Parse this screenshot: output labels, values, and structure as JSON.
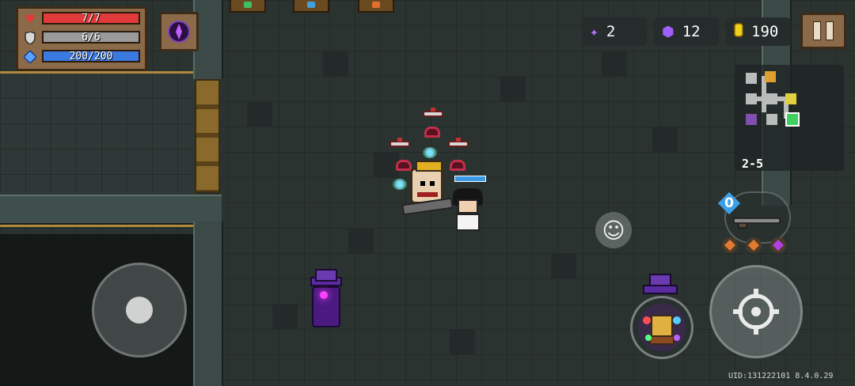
{
  "player_stats": {
    "health": {
      "label": "7/7",
      "current": 7,
      "max": 7,
      "color": "#e03a3a",
      "icon": "heart-icon"
    },
    "armor": {
      "label": "6/6",
      "current": 6,
      "max": 6,
      "color": "#9a9a9a",
      "icon": "shield-icon"
    },
    "energy": {
      "label": "200/200",
      "current": 200,
      "max": 200,
      "color": "#3a7ae0",
      "icon": "energy-crystal-icon"
    }
  },
  "skill_button": {
    "icon": "purple-spirit-skill-icon"
  },
  "resources": {
    "gems": {
      "value": "2",
      "icon": "purple-star-gem-icon",
      "color": "#b070ff"
    },
    "materials": {
      "value": "12",
      "icon": "purple-coin-icon",
      "color": "#a060ff"
    },
    "gold": {
      "value": "190",
      "icon": "gold-coin-icon",
      "color": "#f0d020"
    }
  },
  "pause_button": {
    "icon": "pause-icon"
  },
  "minimap": {
    "level": "2-5"
  },
  "weapon": {
    "energy_cost": "0",
    "icon": "rifle-icon"
  },
  "buffs": [
    {
      "icon": "orange-gem-buff-icon",
      "color": "#e07a30"
    },
    {
      "icon": "orange-gem-buff-icon",
      "color": "#e07a30"
    },
    {
      "icon": "purple-gem-buff-icon",
      "color": "#b040e0"
    }
  ],
  "controls": {
    "joystick": {
      "icon": "joystick-knob"
    },
    "emote": {
      "icon": "smiley-icon"
    },
    "attack": {
      "icon": "crosshair-icon"
    },
    "character_skill": {
      "icon": "character-skill-icon"
    }
  },
  "footer": {
    "uid_text": "UID:131222101 8.4.0.29"
  }
}
